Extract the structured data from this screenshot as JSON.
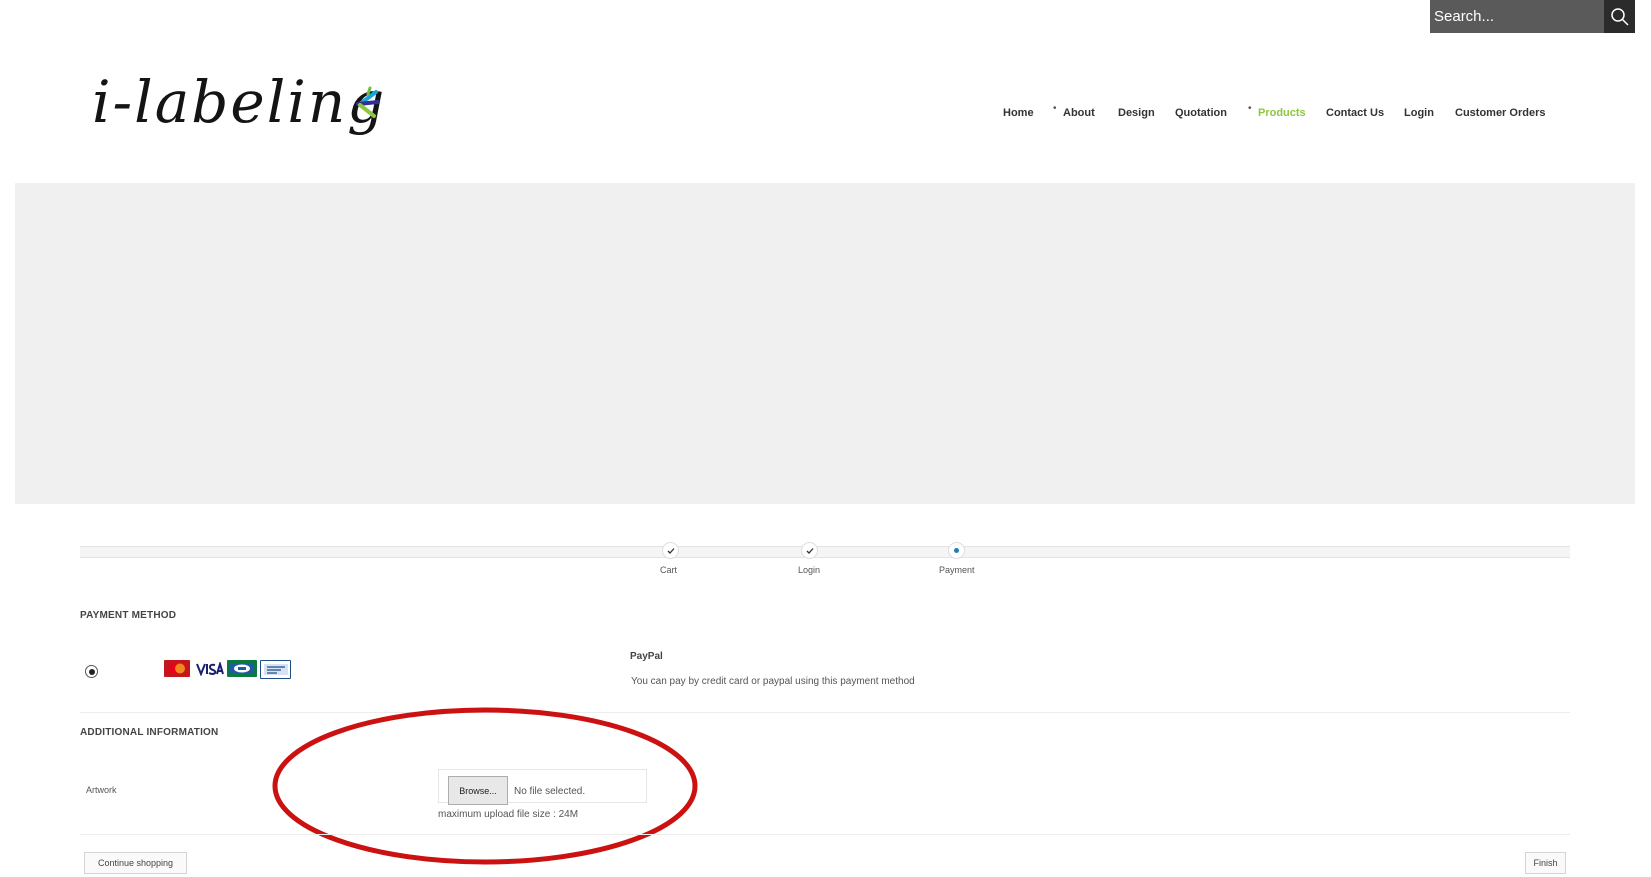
{
  "header": {
    "search": {
      "placeholder": "Search..."
    },
    "logo": {
      "text": "i-labeling"
    }
  },
  "nav": {
    "items": [
      {
        "label": "Home"
      },
      {
        "label": "About"
      },
      {
        "label": "Design"
      },
      {
        "label": "Quotation"
      },
      {
        "label": "Products"
      },
      {
        "label": "Contact Us"
      },
      {
        "label": "Login"
      },
      {
        "label": "Customer Orders"
      }
    ],
    "active": "Products",
    "active_color": "#8dc63f"
  },
  "steps": [
    {
      "label": "Cart",
      "state": "done"
    },
    {
      "label": "Login",
      "state": "done"
    },
    {
      "label": "Payment",
      "state": "current"
    }
  ],
  "payment": {
    "title": "PAYMENT METHOD",
    "method_name": "PayPal",
    "method_description": "You can pay by credit card or paypal using this payment method",
    "selected": true,
    "card_icons": [
      "mastercard-icon",
      "visa-icon",
      "cb-icon",
      "paypal-icon"
    ]
  },
  "additional": {
    "title": "ADDITIONAL INFORMATION",
    "artwork_label": "Artwork",
    "browse_label": "Browse...",
    "file_status": "No file selected.",
    "upload_note": "maximum upload file size : 24M"
  },
  "buttons": {
    "continue_label": "Continue shopping",
    "finish_label": "Finish"
  },
  "colors": {
    "annotation": "#cc1111",
    "step_current": "#1f7fb6"
  }
}
